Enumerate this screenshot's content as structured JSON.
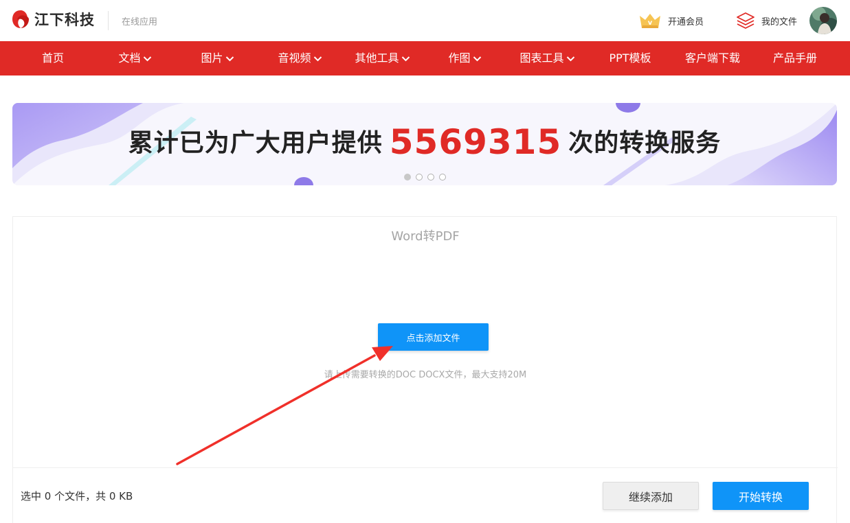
{
  "header": {
    "logo_text": "江下科技",
    "logo_sub": "在线应用",
    "vip_label": "开通会员",
    "files_label": "我的文件"
  },
  "nav": {
    "items": [
      {
        "label": "首页",
        "dropdown": false
      },
      {
        "label": "文档",
        "dropdown": true
      },
      {
        "label": "图片",
        "dropdown": true
      },
      {
        "label": "音视频",
        "dropdown": true
      },
      {
        "label": "其他工具",
        "dropdown": true
      },
      {
        "label": "作图",
        "dropdown": true
      },
      {
        "label": "图表工具",
        "dropdown": true
      },
      {
        "label": "PPT模板",
        "dropdown": false
      },
      {
        "label": "客户端下载",
        "dropdown": false
      },
      {
        "label": "产品手册",
        "dropdown": false
      }
    ]
  },
  "banner": {
    "text_before": "累计已为广大用户提供",
    "count": "5569315",
    "text_after": "次的转换服务",
    "slide_count": 4,
    "active_slide": 1
  },
  "converter": {
    "title": "Word转PDF",
    "add_button": "点击添加文件",
    "hint": "请上传需要转换的DOC DOCX文件，最大支持20M",
    "status": "选中 0 个文件，共 0 KB",
    "continue_button": "继续添加",
    "start_button": "开始转换"
  },
  "colors": {
    "brand_red": "#e02a26",
    "primary_blue": "#0f94f8",
    "annotation_arrow": "#f0302a"
  },
  "icons": {
    "logo": "jiangxia-logo-icon",
    "vip": "crown-icon",
    "files": "layers-icon",
    "nav_dropdown": "chevron-down-icon"
  }
}
